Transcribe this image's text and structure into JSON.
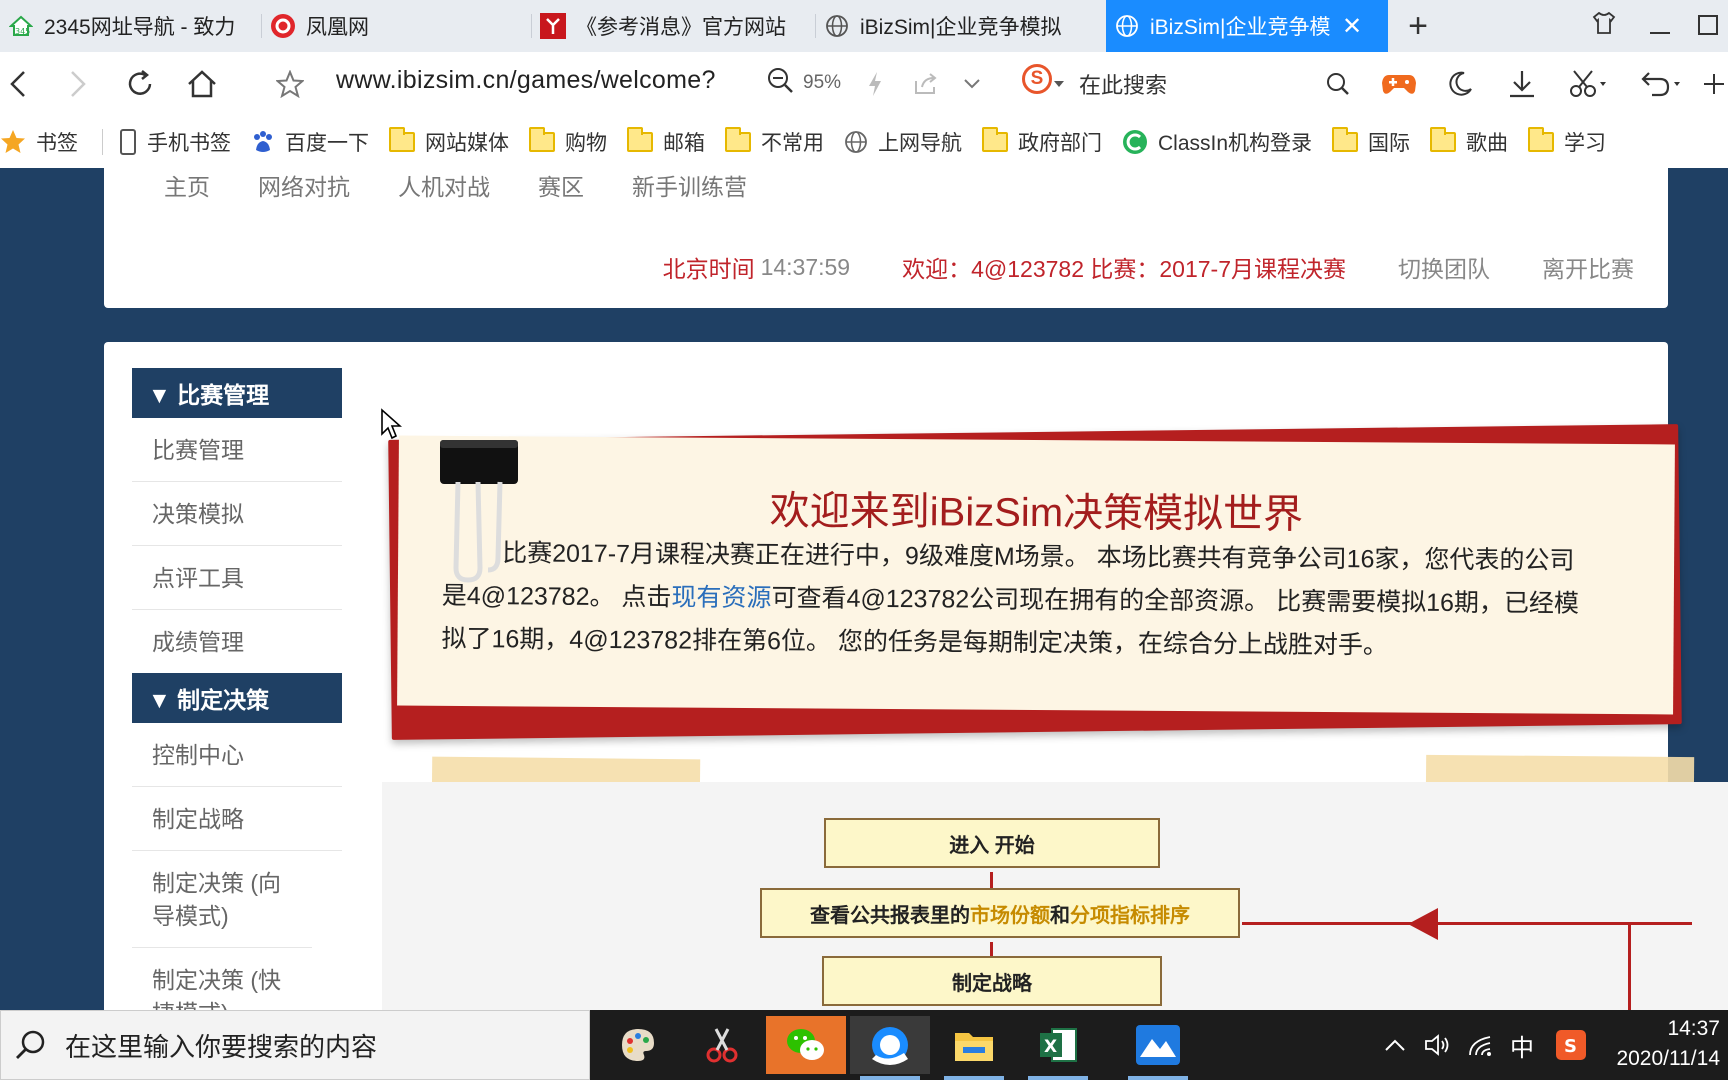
{
  "browser": {
    "tabs": [
      {
        "label": "2345网址导航 - 致力",
        "icon": "house-icon"
      },
      {
        "label": "凤凰网",
        "icon": "phoenix-icon"
      },
      {
        "label": "《参考消息》官方网站",
        "icon": "cankao-icon"
      },
      {
        "label": "iBizSim|企业竞争模拟",
        "icon": "globe-icon"
      },
      {
        "label": "iBizSim|企业竞争模拟",
        "icon": "globe-icon",
        "active": true
      }
    ],
    "url": "www.ibizsim.cn/games/welcome?",
    "zoom": "95%",
    "search_placeholder": "在此搜索",
    "bookmarks": [
      {
        "label": "书签",
        "icon": "star-icon"
      },
      {
        "label": "手机书签",
        "icon": "phone-icon"
      },
      {
        "label": "百度一下",
        "icon": "baidu-icon"
      },
      {
        "label": "网站媒体",
        "icon": "folder-icon"
      },
      {
        "label": "购物",
        "icon": "folder-icon"
      },
      {
        "label": "邮箱",
        "icon": "folder-icon"
      },
      {
        "label": "不常用",
        "icon": "folder-icon"
      },
      {
        "label": "上网导航",
        "icon": "globe-icon"
      },
      {
        "label": "政府部门",
        "icon": "folder-icon"
      },
      {
        "label": "ClassIn机构登录",
        "icon": "classin-icon"
      },
      {
        "label": "国际",
        "icon": "folder-icon"
      },
      {
        "label": "歌曲",
        "icon": "folder-icon"
      },
      {
        "label": "学习",
        "icon": "folder-icon"
      }
    ]
  },
  "site": {
    "nav": [
      "主页",
      "网络对抗",
      "人机对战",
      "赛区",
      "新手训练营"
    ],
    "clock_label": "北京时间",
    "clock_value": "14:37:59",
    "welcome": "欢迎：4@123782 比赛：2017-7月课程决赛",
    "switch_team": "切换团队",
    "leave_game": "离开比赛"
  },
  "sidebar": {
    "section1": "▼ 比赛管理",
    "items1": [
      "比赛管理",
      "决策模拟",
      "点评工具",
      "成绩管理"
    ],
    "section2": "▼ 制定决策",
    "items2": [
      "控制中心",
      "制定战略",
      "制定决策 (向导模式)",
      "制定决策 (快捷模式)"
    ]
  },
  "banner": {
    "title": "欢迎来到iBizSim决策模拟世界",
    "text_before": "比赛2017-7月课程决赛正在进行中，9级难度M场景。 本场比赛共有竞争公司16家，您代表的公司是4@123782。 点击",
    "link": "现有资源",
    "text_after": "可查看4@123782公司现在拥有的全部资源。 比赛需要模拟16期，已经模拟了16期，4@123782排在第6位。 您的任务是每期制定决策，在综合分上战胜对手。"
  },
  "flow": {
    "box1": "进入  开始",
    "box2_a": "查看公共报表里的",
    "box2_b": "市场份额",
    "box2_c": "和",
    "box2_d": "分项指标排序",
    "box3": "制定战略"
  },
  "taskbar": {
    "search_placeholder": "在这里输入你要搜索的内容",
    "ime": "中",
    "time": "14:37",
    "date": "2020/11/14"
  }
}
